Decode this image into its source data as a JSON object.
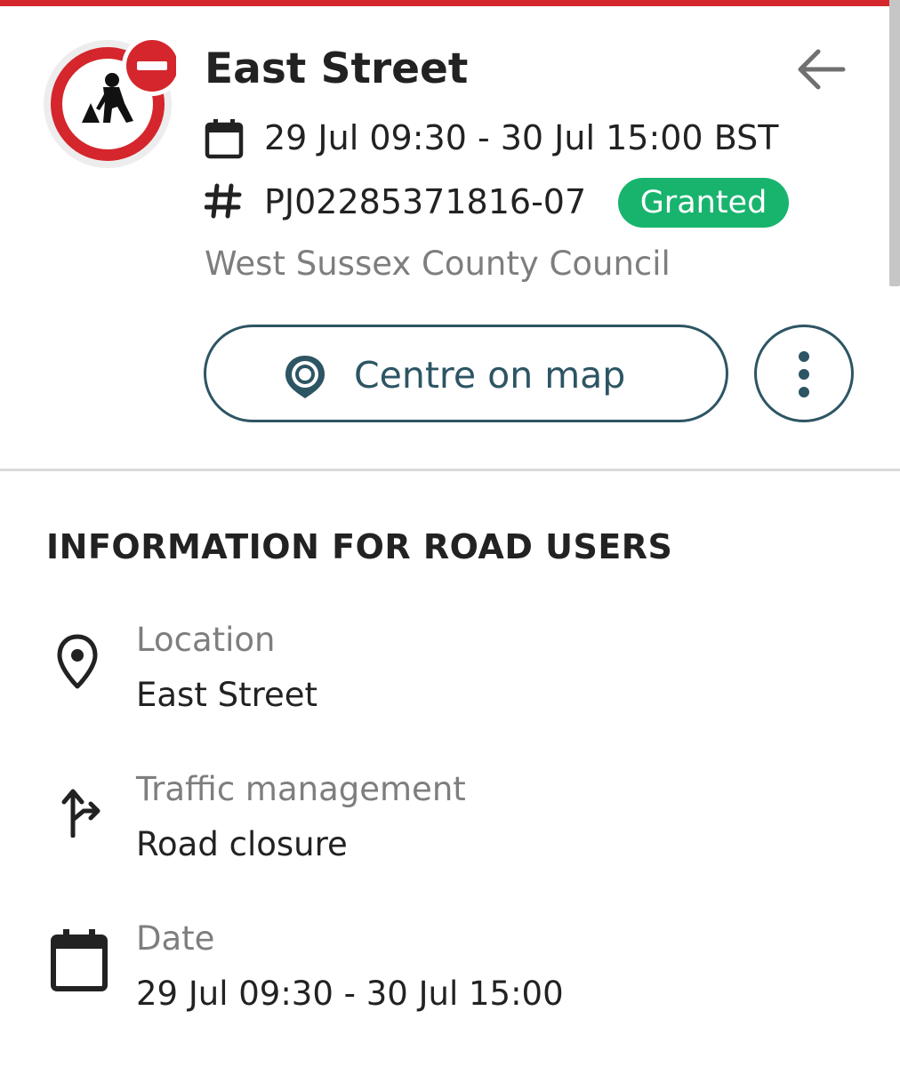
{
  "header": {
    "title": "East Street",
    "date_range": "29 Jul 09:30 - 30 Jul 15:00 BST",
    "reference": "PJ02285371816-07",
    "status": "Granted",
    "authority": "West Sussex County Council",
    "icons": {
      "logo": "roadworks-no-entry-icon",
      "back": "arrow-left-icon",
      "date": "calendar-icon",
      "reference": "hash-icon"
    }
  },
  "actions": {
    "centre_label": "Centre on map",
    "centre_icon": "map-pin-icon",
    "more_icon": "vertical-dots-icon"
  },
  "info": {
    "section_title": "INFORMATION FOR ROAD USERS",
    "items": [
      {
        "label": "Location",
        "value": "East Street",
        "icon": "location-pin-icon"
      },
      {
        "label": "Traffic management",
        "value": "Road closure",
        "icon": "turn-arrow-icon"
      },
      {
        "label": "Date",
        "value": "29 Jul 09:30 - 30 Jul 15:00",
        "icon": "calendar-icon"
      }
    ]
  },
  "colors": {
    "accent_bar": "#d4262c",
    "status_granted": "#18b46e",
    "button_outline": "#2d5564",
    "muted_text": "#7e7e7e"
  }
}
